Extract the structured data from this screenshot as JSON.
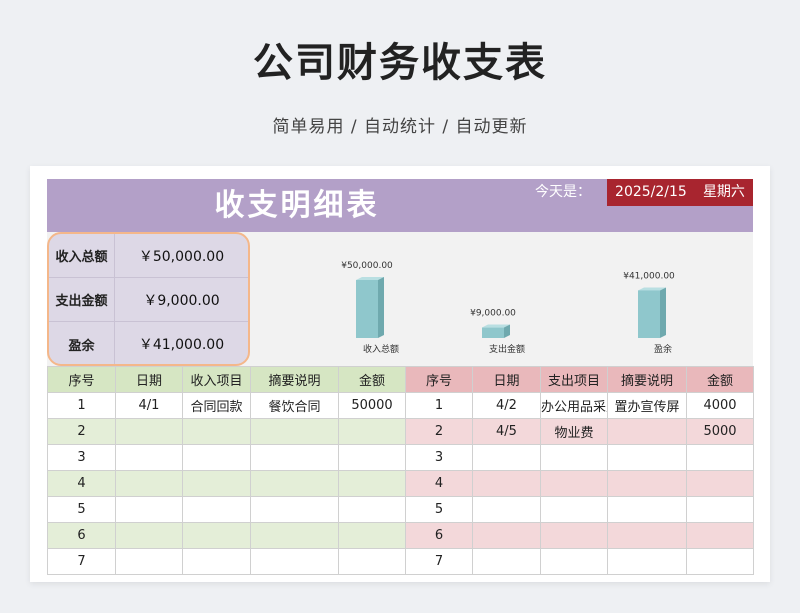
{
  "page": {
    "title": "公司财务收支表",
    "subtitle": "简单易用 / 自动统计 / 自动更新"
  },
  "sheet": {
    "title": "收支明细表",
    "today_label": "今天是：",
    "date": "2025/2/15",
    "weekday": "星期六"
  },
  "summary": [
    {
      "label": "收入总额",
      "value": "￥50,000.00"
    },
    {
      "label": "支出金额",
      "value": "￥9,000.00"
    },
    {
      "label": "盈余",
      "value": "￥41,000.00"
    }
  ],
  "chart_data": {
    "type": "bar",
    "categories": [
      "收入总额",
      "支出金额",
      "盈余"
    ],
    "values": [
      50000,
      9000,
      41000
    ],
    "data_labels": [
      "¥50,000.00",
      "¥9,000.00",
      "¥41,000.00"
    ],
    "color": "#8fc7cc"
  },
  "income_table": {
    "headers": [
      "序号",
      "日期",
      "收入项目",
      "摘要说明",
      "金额"
    ],
    "rows": [
      [
        "1",
        "4/1",
        "合同回款",
        "餐饮合同",
        "50000"
      ],
      [
        "2",
        "",
        "",
        "",
        ""
      ],
      [
        "3",
        "",
        "",
        "",
        ""
      ],
      [
        "4",
        "",
        "",
        "",
        ""
      ],
      [
        "5",
        "",
        "",
        "",
        ""
      ],
      [
        "6",
        "",
        "",
        "",
        ""
      ],
      [
        "7",
        "",
        "",
        "",
        ""
      ]
    ]
  },
  "expense_table": {
    "headers": [
      "序号",
      "日期",
      "支出项目",
      "摘要说明",
      "金额"
    ],
    "rows": [
      [
        "1",
        "4/2",
        "办公用品采购",
        "置办宣传屏",
        "4000"
      ],
      [
        "2",
        "4/5",
        "物业费",
        "",
        "5000"
      ],
      [
        "3",
        "",
        "",
        "",
        ""
      ],
      [
        "4",
        "",
        "",
        "",
        ""
      ],
      [
        "5",
        "",
        "",
        "",
        ""
      ],
      [
        "6",
        "",
        "",
        "",
        ""
      ],
      [
        "7",
        "",
        "",
        "",
        ""
      ]
    ]
  }
}
